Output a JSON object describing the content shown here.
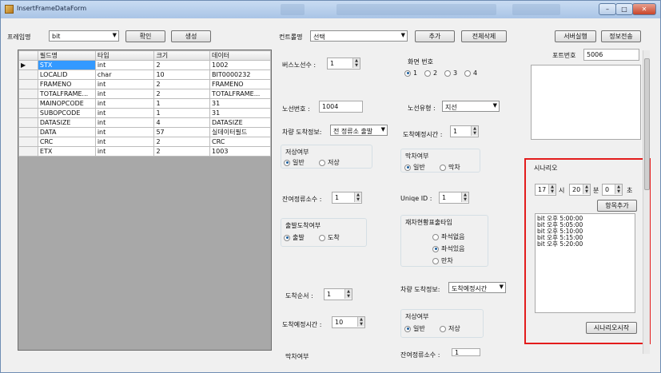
{
  "window": {
    "title": "InsertFrameDataForm",
    "minimize": "–",
    "maximize": "□",
    "close": "✕"
  },
  "top": {
    "frame_label": "프레임명",
    "frame_value": "bit",
    "confirm_btn": "확인",
    "create_btn": "생성",
    "control_label": "컨트롤명",
    "control_value": "선택",
    "add_btn": "추가",
    "delete_all_btn": "전체삭제",
    "server_run_btn": "서버실행",
    "send_info_btn": "정보전송"
  },
  "grid": {
    "headers": [
      "필드명",
      "타입",
      "크기",
      "데이터"
    ],
    "rows": [
      [
        "STX",
        "int",
        "2",
        "1002"
      ],
      [
        "LOCALID",
        "char",
        "10",
        "BIT0000232"
      ],
      [
        "FRAMENO",
        "int",
        "2",
        "FRAMENO"
      ],
      [
        "TOTALFRAME...",
        "int",
        "2",
        "TOTALFRAME..."
      ],
      [
        "MAINOPCODE",
        "int",
        "1",
        "31"
      ],
      [
        "SUBOPCODE",
        "int",
        "1",
        "31"
      ],
      [
        "DATASIZE",
        "int",
        "4",
        "DATASIZE"
      ],
      [
        "DATA",
        "int",
        "57",
        "실데이터필드"
      ],
      [
        "CRC",
        "int",
        "2",
        "CRC"
      ],
      [
        "ETX",
        "int",
        "2",
        "1003"
      ]
    ]
  },
  "controls": {
    "bus_route_count_label": "버스노선수 :",
    "bus_route_count": "1",
    "screen_no_label": "화면 번호",
    "screen_options": [
      "1",
      "2",
      "3",
      "4"
    ],
    "route_no_label": "노선번호 :",
    "route_no": "1004",
    "route_type_label": "노선유형 :",
    "route_type": "지선",
    "arrival_info_label": "차량 도착정보:",
    "arrival_info": "전 정류소 출발",
    "expected_time_label": "도착예정시간 :",
    "expected_time": "1",
    "low_floor_label": "저상여부",
    "normal_opt": "일반",
    "low_opt": "저상",
    "last_bus_label": "막차여부",
    "last_bus_normal": "일반",
    "last_bus_last": "막차",
    "remaining_stops_label": "잔여정류소수 :",
    "remaining_stops": "1",
    "unique_id_label": "Uniqe ID :",
    "unique_id": "1",
    "depart_arrive_label": "출발도착여부",
    "depart_opt": "출발",
    "arrive_opt": "도착",
    "seat_type_label": "재차현황표출타입",
    "seat_opts": [
      "좌석없음",
      "좌석있음",
      "만차"
    ],
    "arrival_order_label": "도착순서 :",
    "arrival_order": "1",
    "arrival_info2_label": "차량 도착정보:",
    "arrival_info2": "도착예정시간",
    "expected_time2_label": "도착예정시간 :",
    "expected_time2": "10",
    "low_floor2_label": "저상여부",
    "normal2_opt": "일반",
    "low2_opt": "저상",
    "cut1_label": "막차여부",
    "cut2_label": "잔여정류소수 :",
    "cut2_value": "1"
  },
  "right": {
    "port_label": "포트번호",
    "port_value": "5006",
    "scenario_label": "시나리오",
    "hour": "17",
    "hour_unit": "시",
    "minute": "20",
    "minute_unit": "분",
    "second": "0",
    "second_unit": "초",
    "add_item_btn": "항목추가",
    "scenario_items": [
      "bit 오후 5:00:00",
      "bit 오후 5:05:00",
      "bit 오후 5:10:00",
      "bit 오후 5:15:00",
      "bit 오후 5:20:00"
    ],
    "start_btn": "시나리오시작"
  }
}
